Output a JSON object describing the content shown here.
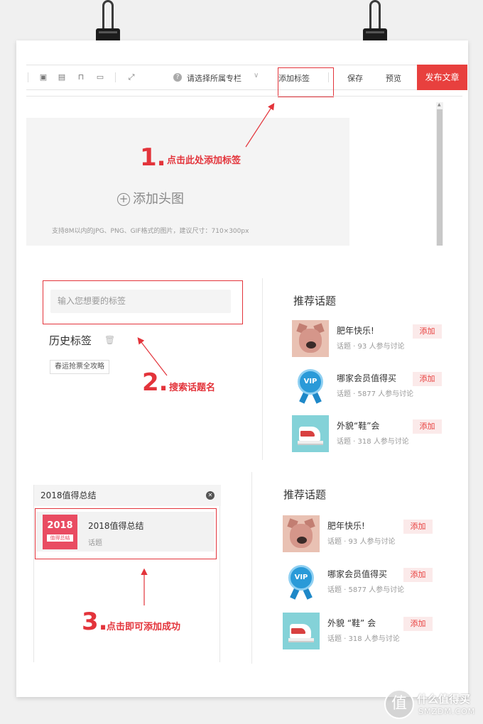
{
  "toolbar": {
    "column_select": "请选择所属专栏",
    "add_tag": "添加标签",
    "save": "保存",
    "preview": "预览",
    "publish": "发布文章"
  },
  "cover": {
    "button": "添加头图",
    "hint": "支持8M以内的JPG、PNG、GIF格式的图片，建议尺寸：710×300px"
  },
  "steps": [
    {
      "num": "1.",
      "text": "点击此处添加标签"
    },
    {
      "num": "2.",
      "text": "搜索话题名"
    },
    {
      "num": "3.",
      "text": "点击即可添加成功"
    }
  ],
  "tag_search": {
    "placeholder": "输入您想要的标签",
    "history_title": "历史标签",
    "history_tags": [
      "春运抢票全攻略"
    ]
  },
  "recommended": {
    "title": "推荐话题",
    "add_label": "添加",
    "topics": [
      {
        "name": "肥年快乐!",
        "meta": "话题 · 93 人参与讨论",
        "icon": "pig-image"
      },
      {
        "name": "哪家会员值得买",
        "meta": "话题 · 5877 人参与讨论",
        "icon": "vip-badge"
      },
      {
        "name": "外貌“鞋”会",
        "meta": "话题 · 318 人参与讨论",
        "icon": "sneaker-image"
      }
    ]
  },
  "recommended2": {
    "topics": [
      {
        "name": "肥年快乐!"
      },
      {
        "name": "哪家会员值得买"
      },
      {
        "name": "外貌  “鞋” 会"
      }
    ]
  },
  "search_result": {
    "query": "2018值得总结",
    "item_name": "2018值得总结",
    "item_meta": "话题",
    "thumb_year": "2018",
    "thumb_label": "值得总结"
  },
  "watermark": {
    "logo": "值",
    "title": "什么值得买",
    "sub": "SMZDM.COM"
  }
}
